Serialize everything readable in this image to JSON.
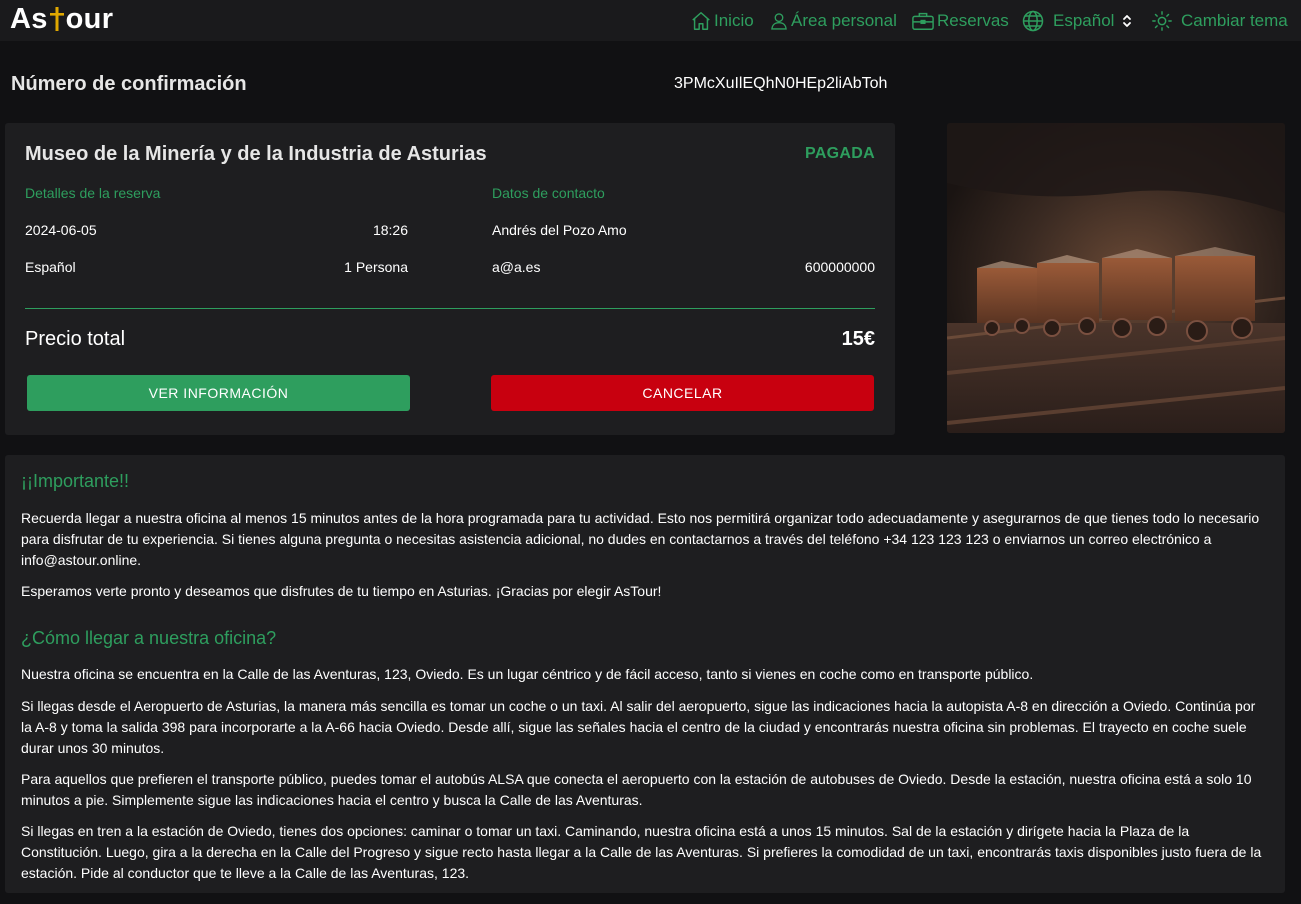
{
  "app": {
    "logo_prefix": "As",
    "logo_suffix": "our"
  },
  "nav": {
    "home": "Inicio",
    "personal_area": "Área personal",
    "bookings": "Reservas",
    "language": "Español",
    "theme": "Cambiar tema"
  },
  "confirmation": {
    "label": "Número de confirmación",
    "code": "3PMcXuIlEQhN0HEp2liAbToh"
  },
  "booking": {
    "title": "Museo de la Minería y de la Industria de Asturias",
    "status": "PAGADA",
    "details_label": "Detalles de la reserva",
    "contact_label": "Datos de contacto",
    "date": "2024-06-05",
    "time": "18:26",
    "language": "Español",
    "people": "1 Persona",
    "contact_name": "Andrés del Pozo Amo",
    "contact_email": "a@a.es",
    "contact_phone": "600000000",
    "price_label": "Precio total",
    "price": "15€",
    "info_button": "VER INFORMACIÓN",
    "cancel_button": "CANCELAR"
  },
  "important": {
    "title": "¡¡Importante!!",
    "p1": "Recuerda llegar a nuestra oficina al menos 15 minutos antes de la hora programada para tu actividad. Esto nos permitirá organizar todo adecuadamente y asegurarnos de que tienes todo lo necesario para disfrutar de tu experiencia. Si tienes alguna pregunta o necesitas asistencia adicional, no dudes en contactarnos a través del teléfono +34 123 123 123 o enviarnos un correo electrónico a info@astour.online.",
    "p2": "Esperamos verte pronto y deseamos que disfrutes de tu tiempo en Asturias. ¡Gracias por elegir AsTour!"
  },
  "directions": {
    "title": "¿Cómo llegar a nuestra oficina?",
    "p1": "Nuestra oficina se encuentra en la Calle de las Aventuras, 123, Oviedo. Es un lugar céntrico y de fácil acceso, tanto si vienes en coche como en transporte público.",
    "p2": "Si llegas desde el Aeropuerto de Asturias, la manera más sencilla es tomar un coche o un taxi. Al salir del aeropuerto, sigue las indicaciones hacia la autopista A-8 en dirección a Oviedo. Continúa por la A-8 y toma la salida 398 para incorporarte a la A-66 hacia Oviedo. Desde allí, sigue las señales hacia el centro de la ciudad y encontrarás nuestra oficina sin problemas. El trayecto en coche suele durar unos 30 minutos.",
    "p3": "Para aquellos que prefieren el transporte público, puedes tomar el autobús ALSA que conecta el aeropuerto con la estación de autobuses de Oviedo. Desde la estación, nuestra oficina está a solo 10 minutos a pie. Simplemente sigue las indicaciones hacia el centro y busca la Calle de las Aventuras.",
    "p4": "Si llegas en tren a la estación de Oviedo, tienes dos opciones: caminar o tomar un taxi. Caminando, nuestra oficina está a unos 15 minutos. Sal de la estación y dirígete hacia la Plaza de la Constitución. Luego, gira a la derecha en la Calle del Progreso y sigue recto hasta llegar a la Calle de las Aventuras. Si prefieres la comodidad de un taxi, encontrarás taxis disponibles justo fuera de la estación. Pide al conductor que te lleve a la Calle de las Aventuras, 123."
  },
  "colors": {
    "accent": "#2e9e5e",
    "danger": "#c8000f",
    "background": "#111113",
    "panel": "#1e1e20",
    "logo_cross": "#e0a800"
  },
  "icons": [
    "home-icon",
    "user-icon",
    "briefcase-icon",
    "globe-icon",
    "chevron-updown-icon",
    "sun-icon"
  ]
}
